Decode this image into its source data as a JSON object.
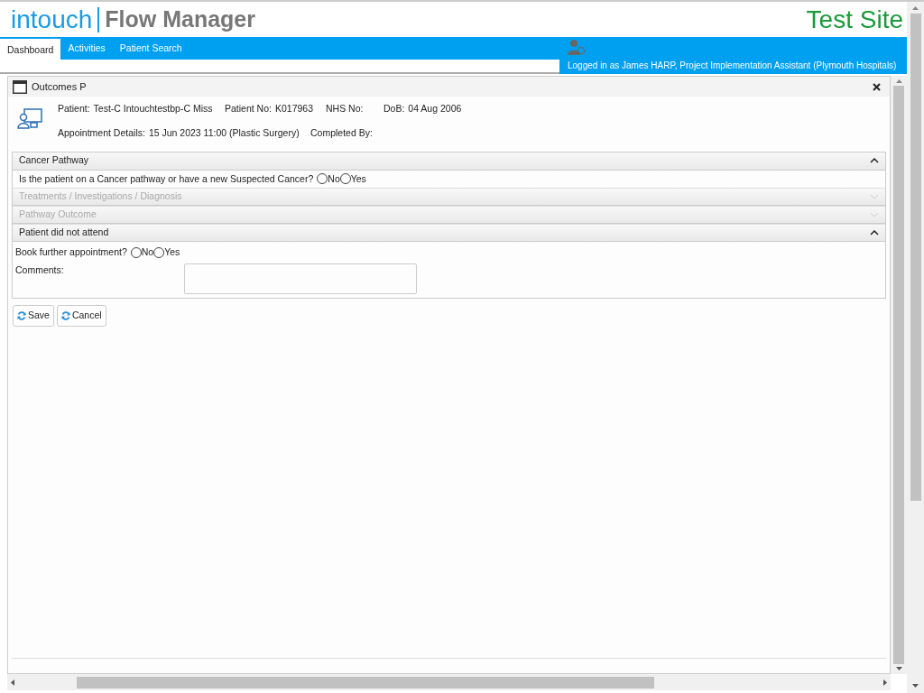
{
  "header": {
    "logo": "intouch",
    "product": "Flow Manager",
    "site_label": "Test Site"
  },
  "nav": {
    "tabs": [
      {
        "label": "Dashboard",
        "selected": true
      },
      {
        "label": "Activities",
        "selected": false
      },
      {
        "label": "Patient Search",
        "selected": false
      }
    ],
    "user_text": "Logged in as James HARP, Project Implementation Assistant (Plymouth Hospitals)"
  },
  "dialog": {
    "title": "Outcomes P",
    "patient": [
      {
        "label": "Patient:",
        "value": "Test-C Intouchtestbp-C Miss"
      },
      {
        "label": "Patient No:",
        "value": "K017963"
      },
      {
        "label": "NHS No:"
      },
      {
        "label": "DoB:",
        "value": "04 Aug 2006"
      }
    ],
    "appointment": [
      {
        "label": "Appointment Details:",
        "value": "15 Jun 2023 11:00 (Plastic Surgery)"
      },
      {
        "label": "Completed By:"
      }
    ],
    "sections": [
      {
        "title": "Cancer Pathway",
        "expanded": true,
        "disabled": false,
        "fields": [
          {
            "kind": "radio",
            "label": "Is the patient on a Cancer pathway or have a new Suspected Cancer?",
            "options": [
              {
                "label": "No",
                "selected": false
              },
              {
                "label": "Yes",
                "selected": false
              }
            ]
          }
        ]
      },
      {
        "title": "Treatments / Investigations / Diagnosis",
        "expanded": false,
        "disabled": true
      },
      {
        "title": "Pathway Outcome",
        "expanded": false,
        "disabled": true
      },
      {
        "title": "Patient did not attend",
        "expanded": true,
        "disabled": false,
        "fields": [
          {
            "kind": "radio",
            "label": "Book further appointment?",
            "options": [
              {
                "label": "No",
                "selected": false
              },
              {
                "label": "Yes",
                "selected": false
              }
            ]
          },
          {
            "kind": "textarea",
            "label": "Comments:"
          }
        ]
      }
    ],
    "buttons": [
      {
        "label": "Save"
      },
      {
        "label": "Cancel"
      }
    ]
  }
}
